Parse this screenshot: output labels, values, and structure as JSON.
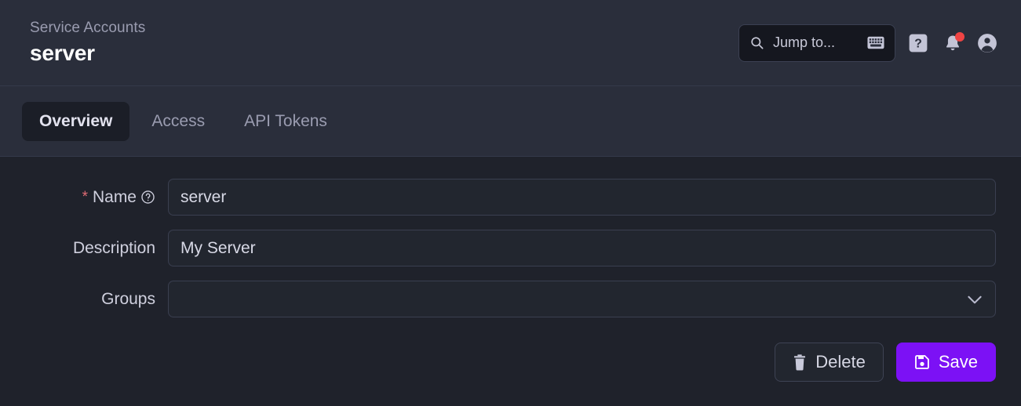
{
  "header": {
    "breadcrumb": "Service Accounts",
    "title": "server",
    "search": {
      "placeholder": "Jump to...",
      "search_icon": "search-icon",
      "keyboard_icon": "keyboard-icon"
    },
    "help_button": {
      "label": "?",
      "icon": "question-mark-icon"
    },
    "notifications": {
      "icon": "bell-icon",
      "has_badge": true,
      "badge_color": "#ef4444"
    },
    "account": {
      "icon": "user-avatar-icon"
    }
  },
  "tabs": [
    {
      "label": "Overview",
      "active": true
    },
    {
      "label": "Access",
      "active": false
    },
    {
      "label": "API Tokens",
      "active": false
    }
  ],
  "form": {
    "fields": [
      {
        "label": "Name",
        "required": true,
        "required_marker": "*",
        "has_help": true,
        "help_icon": "question-circle-icon",
        "value": "server",
        "type": "text"
      },
      {
        "label": "Description",
        "required": false,
        "has_help": false,
        "value": "My Server",
        "type": "text"
      },
      {
        "label": "Groups",
        "required": false,
        "has_help": false,
        "value": "",
        "type": "select",
        "chevron_icon": "chevron-down-icon"
      }
    ]
  },
  "actions": {
    "delete": {
      "label": "Delete",
      "icon": "trash-icon"
    },
    "save": {
      "label": "Save",
      "icon": "floppy-disk-save-icon"
    }
  },
  "colors": {
    "page_background": "#1f222b",
    "header_background": "#2a2e3b",
    "accent": "#7c11f5",
    "required_star": "#e06c75",
    "badge": "#ef4444",
    "muted_text": "#9a9cb0"
  }
}
